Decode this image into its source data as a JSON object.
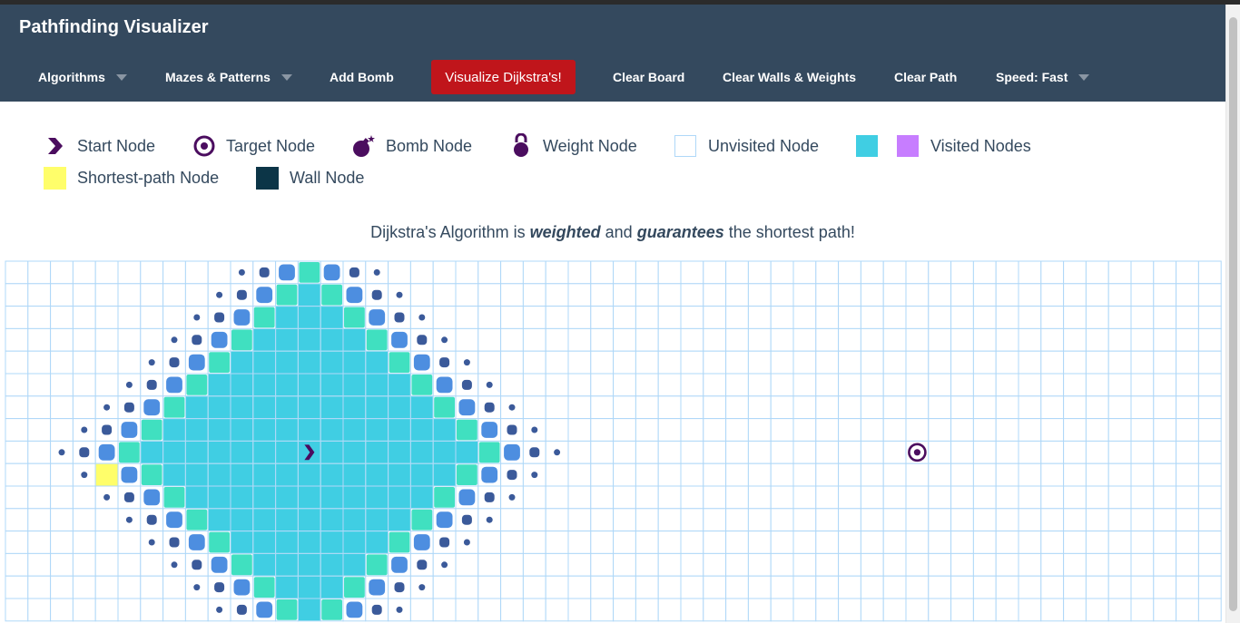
{
  "app": {
    "title": "Pathfinding Visualizer"
  },
  "nav": {
    "algorithms": "Algorithms",
    "mazes": "Mazes & Patterns",
    "add_bomb": "Add Bomb",
    "visualize": "Visualize Dijkstra's!",
    "clear_board": "Clear Board",
    "clear_walls": "Clear Walls & Weights",
    "clear_path": "Clear Path",
    "speed": "Speed: Fast"
  },
  "legend": {
    "start": "Start Node",
    "target": "Target Node",
    "bomb": "Bomb Node",
    "weight": "Weight Node",
    "unvisited": "Unvisited Node",
    "visited": "Visited Nodes",
    "shortest": "Shortest-path Node",
    "wall": "Wall Node"
  },
  "description": {
    "part1": "Dijkstra's Algorithm is ",
    "em1": "weighted",
    "part2": " and ",
    "em2": "guarantees",
    "part3": " the shortest path!"
  },
  "colors": {
    "navbar": "#34495e",
    "visualize_button": "#c0151b",
    "grid_line": "#afd8f8",
    "visited": "#40cee3",
    "visited_alt": "#c77dff",
    "visited_frontier": "#40e0c0",
    "visiting_blue": "#4d8ee0",
    "frontier_dot": "#3b5a9a",
    "shortest_path": "#fffe6a",
    "wall": "#0c3547",
    "start_target": "#4b0d5f"
  },
  "icons": {
    "start": "chevron-right-icon",
    "target": "target-icon",
    "bomb": "bomb-icon",
    "weight": "kettlebell-icon"
  },
  "board": {
    "columns": 54,
    "rows": 16,
    "start": [
      13,
      8
    ],
    "target": [
      40,
      8
    ],
    "shortest_path": [
      [
        4,
        9
      ]
    ],
    "animation_state": "visiting"
  }
}
